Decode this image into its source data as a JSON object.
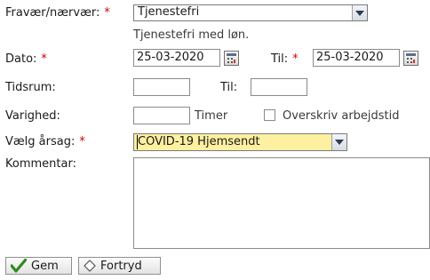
{
  "form": {
    "absence": {
      "label": "Fravær/nærvær:",
      "value": "Tjenestefri",
      "description": "Tjenestefri med løn."
    },
    "date": {
      "label": "Dato:",
      "from_value": "25-03-2020",
      "to_label": "Til:",
      "to_value": "25-03-2020"
    },
    "timespan": {
      "label": "Tidsrum:",
      "from_value": "",
      "to_label": "Til:",
      "to_value": ""
    },
    "duration": {
      "label": "Varighed:",
      "value": "",
      "unit": "Timer",
      "override_label": "Overskriv arbejdstid",
      "override_checked": false
    },
    "reason": {
      "label": "Vælg årsag:",
      "value": "COVID-19 Hjemsendt",
      "highlight_color": "#fdf0a0"
    },
    "comment": {
      "label": "Kommentar:",
      "value": ""
    },
    "required_marker": "*"
  },
  "buttons": {
    "save": "Gem",
    "cancel": "Fortryd"
  },
  "colors": {
    "required": "#cc0000",
    "check_icon": "#2e8b1e"
  }
}
